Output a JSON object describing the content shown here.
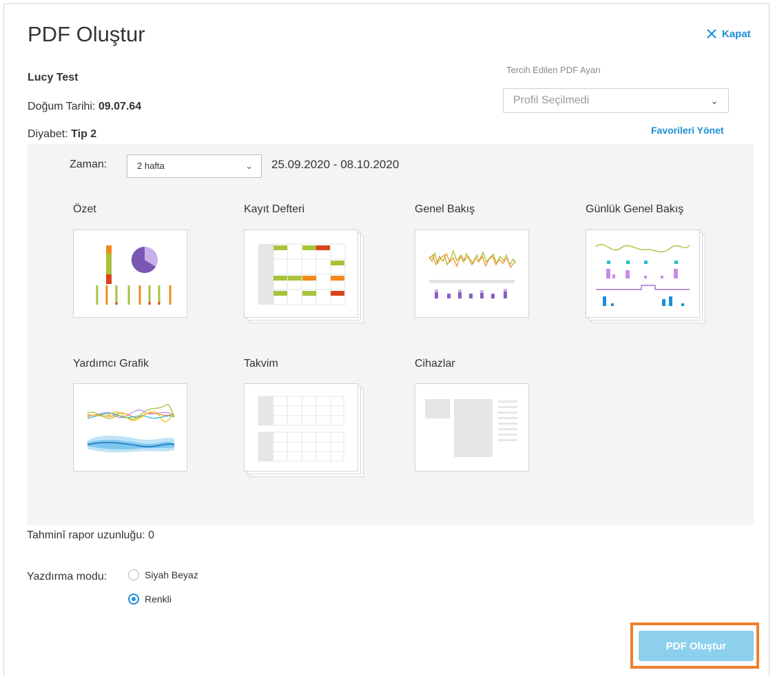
{
  "dialog": {
    "title": "PDF Oluştur",
    "close_label": "Kapat"
  },
  "patient": {
    "name": "Lucy Test",
    "dob_label": "Doğum Tarihi: ",
    "dob_value": "09.07.64",
    "diabetes_label": "Diyabet: ",
    "diabetes_value": "Tip 2"
  },
  "preference": {
    "label": "Tercih Edilen PDF Ayarı",
    "selected": "Profil Seçilmedi",
    "manage_favorites": "Favorileri Yönet"
  },
  "time": {
    "label": "Zaman:",
    "selected": "2 hafta",
    "range": "25.09.2020 - 08.10.2020"
  },
  "reports": [
    {
      "label": "Özet"
    },
    {
      "label": "Kayıt Defteri"
    },
    {
      "label": "Genel Bakış"
    },
    {
      "label": "Günlük Genel Bakış"
    },
    {
      "label": "Yardımcı Grafik"
    },
    {
      "label": "Takvim"
    },
    {
      "label": "Cihazlar"
    }
  ],
  "report_length": "Tahminî rapor uzunluğu: 0",
  "print_mode": {
    "label": "Yazdırma modu:",
    "options": [
      "Siyah Beyaz",
      "Renkli"
    ],
    "selected": "Renkli"
  },
  "submit_label": "PDF Oluştur",
  "colors": {
    "accent": "#1a8fd9",
    "button_disabled": "#8dd0ee",
    "highlight": "#f07f2d"
  }
}
